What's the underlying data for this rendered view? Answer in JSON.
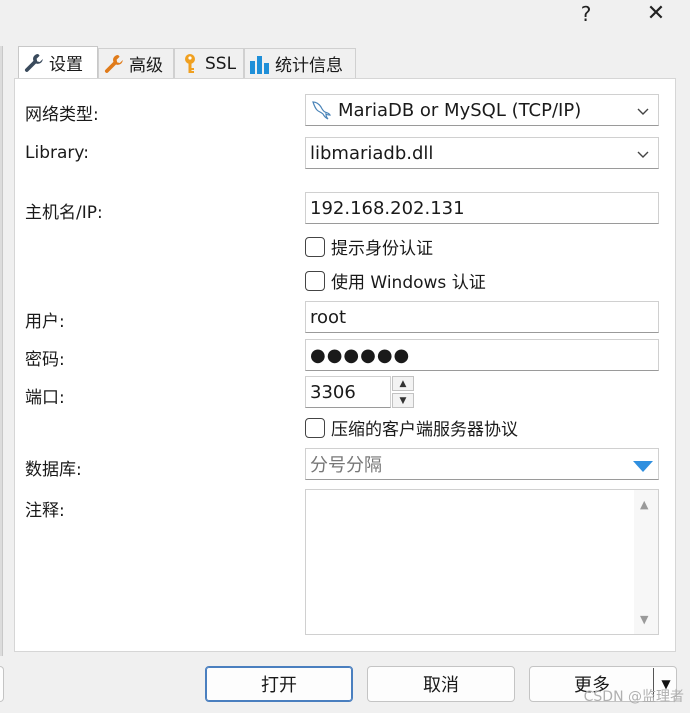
{
  "titlebar": {
    "help": "?",
    "close": "✕"
  },
  "tabs": [
    {
      "label": "设置",
      "icon": "wrench-icon",
      "active": true
    },
    {
      "label": "高级",
      "icon": "wrench-icon-orange",
      "active": false
    },
    {
      "label": "SSL",
      "icon": "key-icon",
      "active": false
    },
    {
      "label": "统计信息",
      "icon": "bar-chart-icon",
      "active": false
    }
  ],
  "form": {
    "network_type": {
      "label": "网络类型:",
      "value": "MariaDB or MySQL (TCP/IP)"
    },
    "library": {
      "label": "Library:",
      "value": "libmariadb.dll"
    },
    "hostname": {
      "label": "主机名/IP:",
      "value": "192.168.202.131"
    },
    "prompt_credentials": {
      "label": "提示身份认证",
      "checked": false
    },
    "windows_auth": {
      "label": "使用 Windows 认证",
      "checked": false
    },
    "user": {
      "label": "用户:",
      "value": "root"
    },
    "password": {
      "label": "密码:",
      "value": "●●●●●●"
    },
    "port": {
      "label": "端口:",
      "value": "3306",
      "up": "▲",
      "down": "▼"
    },
    "compression": {
      "label": "压缩的客户端服务器协议",
      "checked": false
    },
    "databases": {
      "label": "数据库:",
      "placeholder": "分号分隔"
    },
    "comment": {
      "label": "注释:",
      "value": "",
      "scroll_up": "▲",
      "scroll_down": "▼"
    }
  },
  "buttons": {
    "open": "打开",
    "cancel": "取消",
    "more": "更多",
    "more_arrow": "▼"
  },
  "watermark": "CSDN @监理者",
  "colors": {
    "accent": "#2f8fdf",
    "primary_border": "#4a7fbf",
    "key_orange": "#f0a020",
    "chart_blue": "#1f8fd8"
  }
}
